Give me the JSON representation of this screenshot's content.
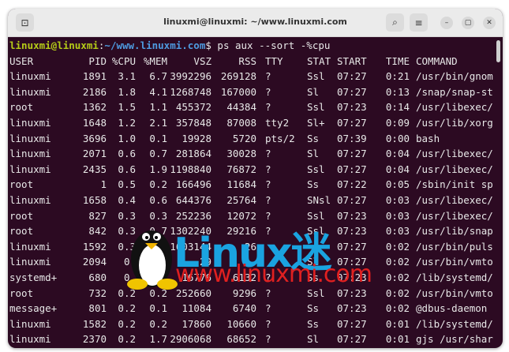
{
  "window": {
    "title": "linuxmi@linuxmi: ~/www.linuxmi.com"
  },
  "icons": {
    "new_tab": "terminal-tab-icon",
    "search": "search-icon",
    "menu": "hamburger-menu-icon",
    "minimize": "minimize-icon",
    "maximize": "maximize-icon",
    "close": "close-icon"
  },
  "terminal": {
    "prompt_user": "linuxmi@linuxmi",
    "prompt_sep": ":",
    "prompt_path": "~/www.linuxmi.com",
    "prompt_end": "$ ",
    "command": "ps aux --sort -%cpu",
    "headers": [
      "USER",
      "PID",
      "%CPU",
      "%MEM",
      "VSZ",
      "RSS",
      "TTY",
      "STAT",
      "START",
      "TIME",
      "COMMAND"
    ],
    "rows": [
      [
        "linuxmi",
        "1891",
        "3.1",
        "6.7",
        "3992296",
        "269128",
        "?",
        "Ssl",
        "07:27",
        "0:21",
        "/usr/bin/gnom"
      ],
      [
        "linuxmi",
        "2186",
        "1.8",
        "4.1",
        "1268748",
        "167000",
        "?",
        "Sl",
        "07:27",
        "0:13",
        "/snap/snap-st"
      ],
      [
        "root",
        "1362",
        "1.5",
        "1.1",
        "455372",
        "44384",
        "?",
        "Ssl",
        "07:23",
        "0:14",
        "/usr/libexec/"
      ],
      [
        "linuxmi",
        "1648",
        "1.2",
        "2.1",
        "357848",
        "87008",
        "tty2",
        "Sl+",
        "07:27",
        "0:09",
        "/usr/lib/xorg"
      ],
      [
        "linuxmi",
        "3696",
        "1.0",
        "0.1",
        "19928",
        "5720",
        "pts/2",
        "Ss",
        "07:39",
        "0:00",
        "bash"
      ],
      [
        "linuxmi",
        "2071",
        "0.6",
        "0.7",
        "281864",
        "30028",
        "?",
        "Sl",
        "07:27",
        "0:04",
        "/usr/libexec/"
      ],
      [
        "linuxmi",
        "2435",
        "0.6",
        "1.9",
        "1198840",
        "76872",
        "?",
        "Ssl",
        "07:27",
        "0:04",
        "/usr/libexec/"
      ],
      [
        "root",
        "1",
        "0.5",
        "0.2",
        "166496",
        "11684",
        "?",
        "Ss",
        "07:22",
        "0:05",
        "/sbin/init sp"
      ],
      [
        "linuxmi",
        "1658",
        "0.4",
        "0.6",
        "644376",
        "25764",
        "?",
        "SNsl",
        "07:27",
        "0:03",
        "/usr/libexec/"
      ],
      [
        "root",
        "827",
        "0.3",
        "0.3",
        "252236",
        "12072",
        "?",
        "Ssl",
        "07:23",
        "0:03",
        "/usr/libexec/"
      ],
      [
        "root",
        "842",
        "0.3",
        "0.7",
        "1302240",
        "29216",
        "?",
        "Ssl",
        "07:23",
        "0:03",
        "/usr/lib/snap"
      ],
      [
        "linuxmi",
        "1592",
        "0.3",
        "",
        "1603144",
        "26",
        "",
        "",
        "07:27",
        "0:02",
        "/usr/bin/puls"
      ],
      [
        "linuxmi",
        "2094",
        "0.",
        "",
        "29",
        "",
        "",
        "Sl",
        "07:27",
        "0:02",
        "/usr/bin/vmto"
      ],
      [
        "systemd+",
        "680",
        "0.",
        "",
        "16776",
        "6132",
        "?",
        "Ss",
        "07:23",
        "0:02",
        "/lib/systemd/"
      ],
      [
        "root",
        "732",
        "0.2",
        "0.2",
        "252660",
        "9296",
        "?",
        "Ssl",
        "07:23",
        "0:02",
        "/usr/bin/vmto"
      ],
      [
        "message+",
        "801",
        "0.2",
        "0.1",
        "11084",
        "6740",
        "?",
        "Ss",
        "07:23",
        "0:02",
        "@dbus-daemon"
      ],
      [
        "linuxmi",
        "1582",
        "0.2",
        "0.2",
        "17860",
        "10660",
        "?",
        "Ss",
        "07:27",
        "0:01",
        "/lib/systemd/"
      ],
      [
        "linuxmi",
        "2370",
        "0.2",
        "1.7",
        "2906068",
        "68652",
        "?",
        "Sl",
        "07:27",
        "0:01",
        "gjs /usr/shar"
      ]
    ]
  },
  "watermark": {
    "logo_text": "Linux迷",
    "url": "www.linuxmi.com"
  },
  "colors": {
    "terminal_bg": "#2c0a22",
    "prompt_user": "#b5cc18",
    "prompt_path": "#4e9be0",
    "watermark_blue": "#1aa3e0",
    "watermark_red": "#e02020"
  }
}
